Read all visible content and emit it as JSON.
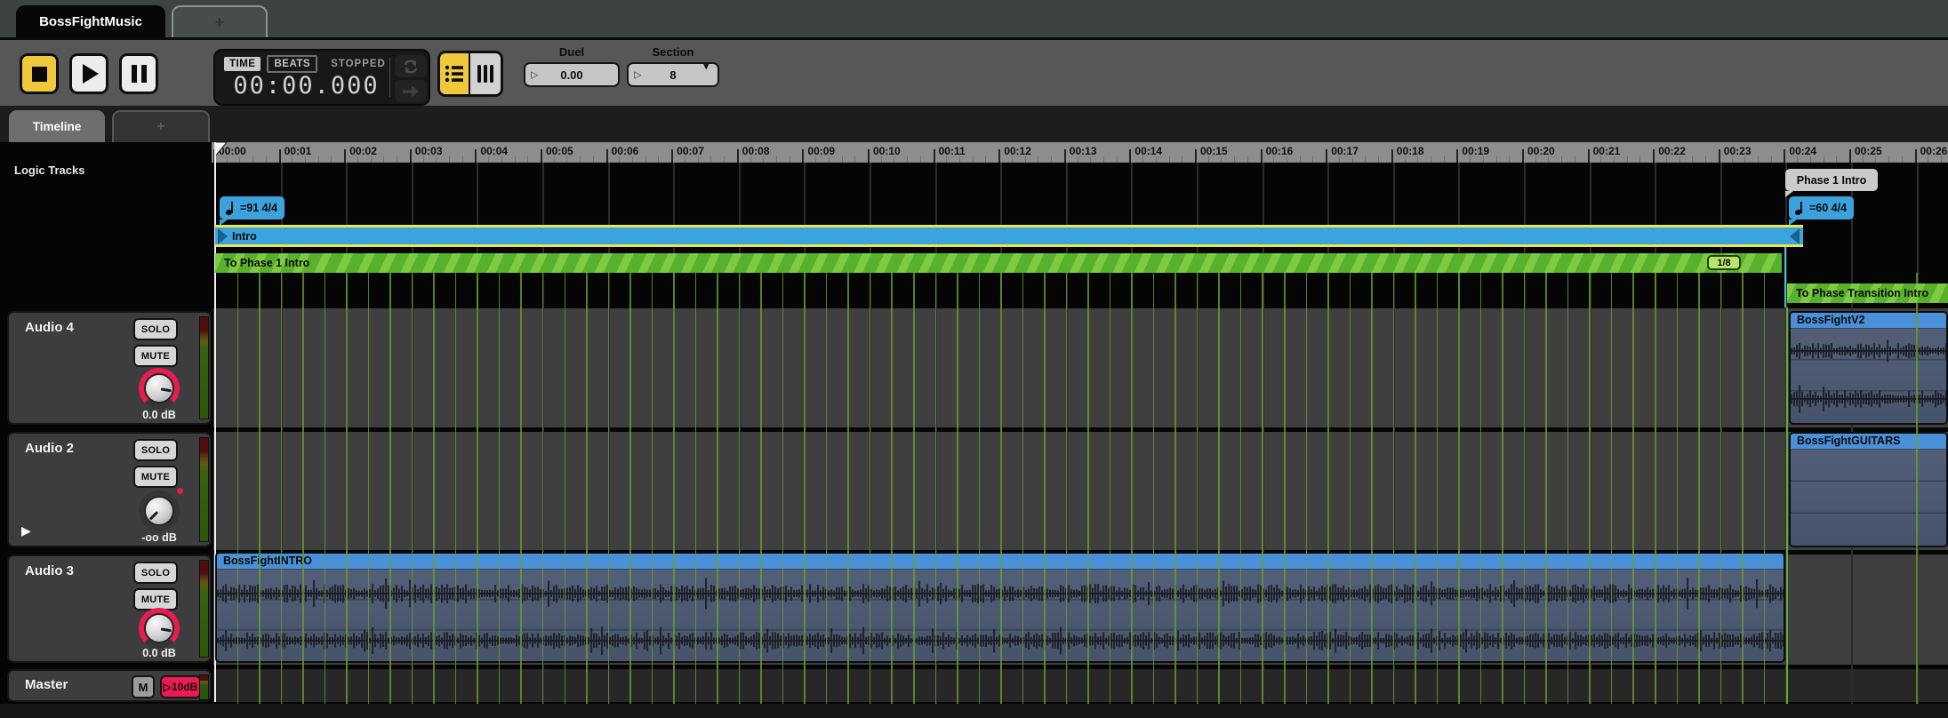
{
  "window": {
    "tab_title": "BossFightMusic",
    "new_tab_label": "+"
  },
  "transport": {
    "stop_icon": "stop-square",
    "play_icon": "play-triangle",
    "pause_icon": "pause-bars"
  },
  "time_panel": {
    "time_label": "TIME",
    "beats_label": "BEATS",
    "status": "STOPPED",
    "time_display": "00:00.000",
    "loop_icon": "loop-arrows",
    "follow_icon": "right-arrow"
  },
  "toolbar": {
    "duel": {
      "label": "Duel",
      "value": "0.00"
    },
    "section": {
      "label": "Section",
      "value": "8"
    }
  },
  "icons": {
    "spinner_triangle": "▷",
    "dropdown_arrow": "▾",
    "expand_arrow": "▶"
  },
  "tabs": {
    "timeline": "Timeline",
    "add": "+"
  },
  "ruler": {
    "labels": [
      "00:00",
      "00:01",
      "00:02",
      "00:03",
      "00:04",
      "00:05",
      "00:06",
      "00:07",
      "00:08",
      "00:09",
      "00:10",
      "00:11",
      "00:12",
      "00:13",
      "00:14",
      "00:15",
      "00:16",
      "00:17",
      "00:18",
      "00:19",
      "00:20",
      "00:21",
      "00:22",
      "00:23",
      "00:24",
      "00:25",
      "00:26"
    ]
  },
  "logic": {
    "section_label": "Logic Tracks",
    "tempo_marker_1": "=91 4/4",
    "tempo_marker_2": "=60 4/4",
    "marker_flag": "Phase 1 Intro",
    "intro_clip": "Intro",
    "transition_1": {
      "label": "To Phase 1 Intro",
      "badge": "1/8"
    },
    "transition_2": {
      "label": "To Phase Transition Intro"
    }
  },
  "tracks": [
    {
      "name": "Audio 4",
      "solo": "SOLO",
      "mute": "MUTE",
      "db": "0.0 dB"
    },
    {
      "name": "Audio 2",
      "solo": "SOLO",
      "mute": "MUTE",
      "db": "-oo dB"
    },
    {
      "name": "Audio 3",
      "solo": "SOLO",
      "mute": "MUTE",
      "db": "0.0 dB"
    },
    {
      "name": "Master",
      "mute_short": "M",
      "boost": "10dB"
    }
  ],
  "clips": [
    {
      "label": "BossFightV2"
    },
    {
      "label": "BossFightGUITARS"
    },
    {
      "label": "BossFightINTRO"
    }
  ],
  "colors": {
    "accent_yellow": "#f0c83c",
    "accent_crimson": "#ea1b4e",
    "clip_header_blue": "#4a90d8",
    "marker_blue": "#3da2dc",
    "transition_green": "#58b12c",
    "ruler_gray": "#8d8d8d",
    "track_row_gray": "#3f3f3f"
  }
}
